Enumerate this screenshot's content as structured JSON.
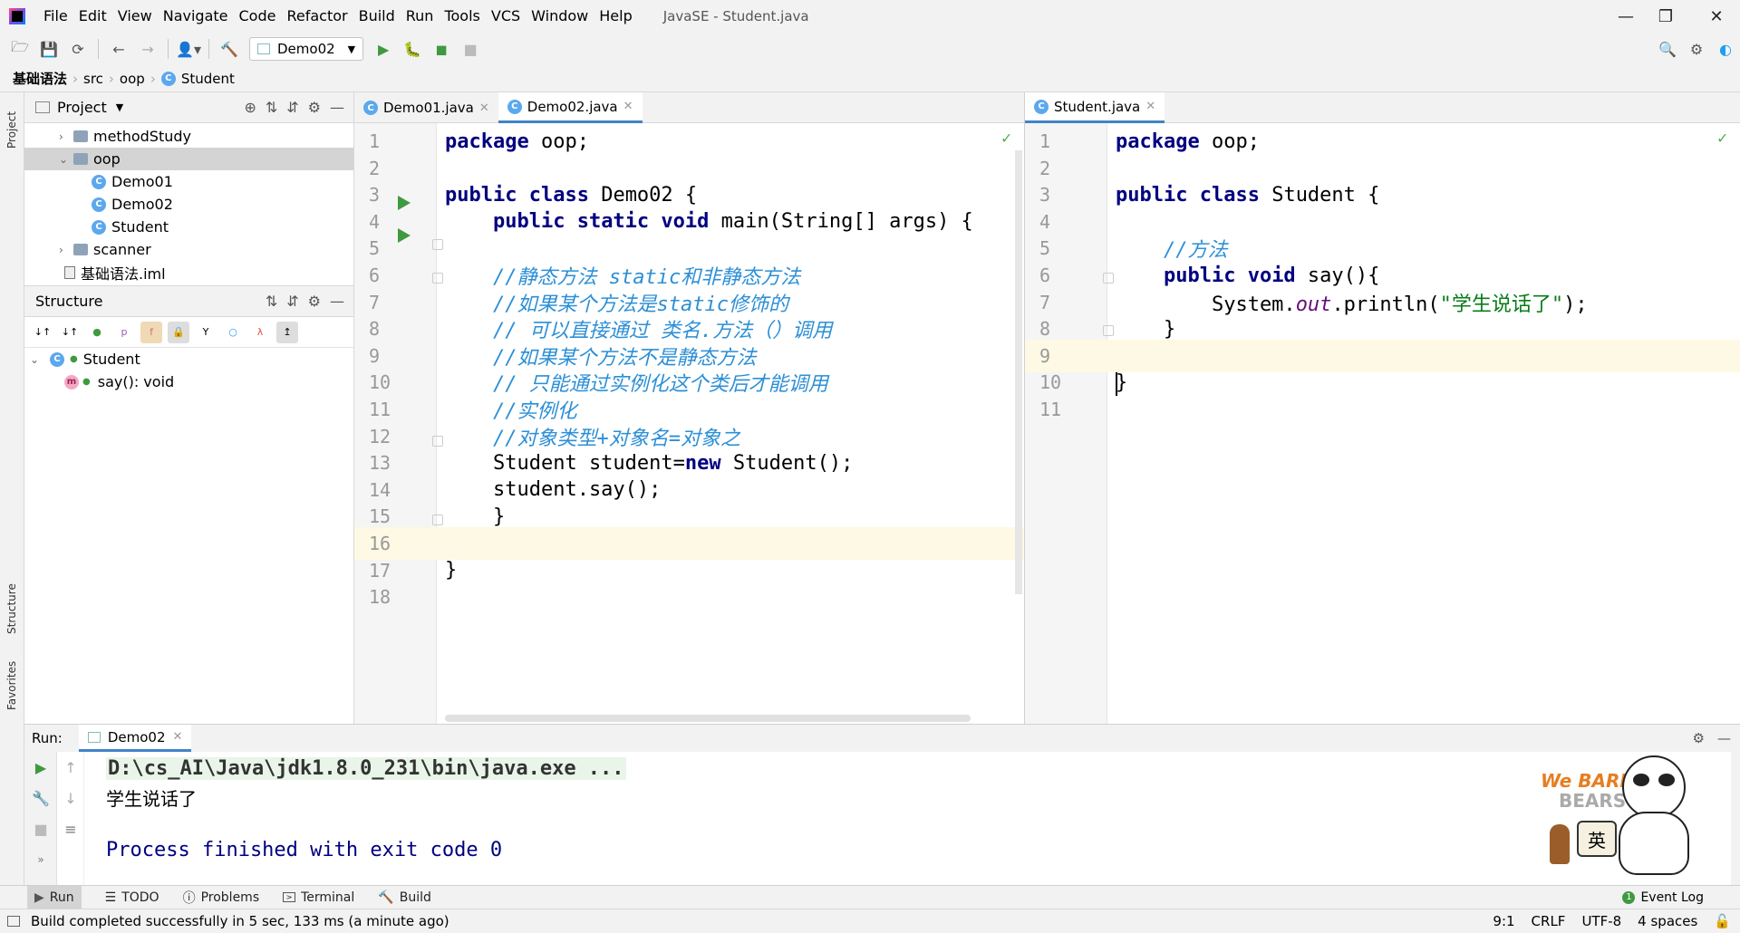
{
  "menubar": {
    "items": [
      "File",
      "Edit",
      "View",
      "Navigate",
      "Code",
      "Refactor",
      "Build",
      "Run",
      "Tools",
      "VCS",
      "Window",
      "Help"
    ],
    "title": "JavaSE - Student.java"
  },
  "toolbar": {
    "run_config": "Demo02"
  },
  "breadcrumb": [
    "基础语法",
    "src",
    "oop",
    "Student"
  ],
  "project_panel": {
    "title": "Project",
    "tab_label": "Project",
    "tree": [
      {
        "label": "methodStudy",
        "type": "folder",
        "indent": 1,
        "expanded": false
      },
      {
        "label": "oop",
        "type": "folder",
        "indent": 1,
        "expanded": true,
        "selected": true
      },
      {
        "label": "Demo01",
        "type": "class",
        "indent": 2
      },
      {
        "label": "Demo02",
        "type": "class",
        "indent": 2
      },
      {
        "label": "Student",
        "type": "class",
        "indent": 2
      },
      {
        "label": "scanner",
        "type": "folder",
        "indent": 1,
        "expanded": false
      },
      {
        "label": "基础语法.iml",
        "type": "file",
        "indent": 1
      }
    ]
  },
  "structure_panel": {
    "title": "Structure",
    "tab_label": "Structure",
    "tree": [
      {
        "label": "Student",
        "kind": "class"
      },
      {
        "label": "say(): void",
        "kind": "method"
      }
    ]
  },
  "favorites_tab": "Favorites",
  "editor_left": {
    "tabs": [
      {
        "label": "Demo01.java",
        "active": false
      },
      {
        "label": "Demo02.java",
        "active": true
      }
    ],
    "lines": [
      {
        "n": "1",
        "html": "<span class='kw'>package</span> oop;"
      },
      {
        "n": "2",
        "html": ""
      },
      {
        "n": "3",
        "html": "<span class='kw'>public class</span> Demo02 {"
      },
      {
        "n": "4",
        "html": "    <span class='kw'>public static void</span> main(String[] args) {"
      },
      {
        "n": "5",
        "html": ""
      },
      {
        "n": "6",
        "html": "    <span class='cm'>//静态方法 static和非静态方法</span>"
      },
      {
        "n": "7",
        "html": "    <span class='cm'>//如果某个方法是static修饰的</span>"
      },
      {
        "n": "8",
        "html": "    <span class='cm'>// 可以直接通过 类名.方法（）调用</span>"
      },
      {
        "n": "9",
        "html": "    <span class='cm'>//如果某个方法不是静态方法</span>"
      },
      {
        "n": "10",
        "html": "    <span class='cm'>// 只能通过实例化这个类后才能调用</span>"
      },
      {
        "n": "11",
        "html": "    <span class='cm'>//实例化</span>"
      },
      {
        "n": "12",
        "html": "    <span class='cm'>//对象类型+对象名=对象之</span>"
      },
      {
        "n": "13",
        "html": "    Student student=<span class='kw'>new</span> Student();"
      },
      {
        "n": "14",
        "html": "    student.say();"
      },
      {
        "n": "15",
        "html": "    }"
      },
      {
        "n": "16",
        "html": ""
      },
      {
        "n": "17",
        "html": "}"
      },
      {
        "n": "18",
        "html": ""
      }
    ]
  },
  "editor_right": {
    "tabs": [
      {
        "label": "Student.java",
        "active": true
      }
    ],
    "lines": [
      {
        "n": "1",
        "html": "<span class='kw'>package</span> oop;"
      },
      {
        "n": "2",
        "html": ""
      },
      {
        "n": "3",
        "html": "<span class='kw'>public class</span> Student {"
      },
      {
        "n": "4",
        "html": ""
      },
      {
        "n": "5",
        "html": "    <span class='cm'>//方法</span>"
      },
      {
        "n": "6",
        "html": "    <span class='kw'>public void</span> say(){"
      },
      {
        "n": "7",
        "html": "        System.<span class='fld'>out</span>.println(<span class='str'>\"学生说话了\"</span>);"
      },
      {
        "n": "8",
        "html": "    }"
      },
      {
        "n": "9",
        "html": ""
      },
      {
        "n": "10",
        "html": "}"
      },
      {
        "n": "11",
        "html": ""
      }
    ]
  },
  "run_panel": {
    "label": "Run:",
    "tab": "Demo02",
    "output": [
      "D:\\cs_AI\\Java\\jdk1.8.0_231\\bin\\java.exe ...",
      "学生说话了",
      "",
      "Process finished with exit code 0"
    ]
  },
  "bottom_tabs": [
    "Run",
    "TODO",
    "Problems",
    "Terminal",
    "Build"
  ],
  "event_log": "Event Log",
  "status": {
    "message": "Build completed successfully in 5 sec, 133 ms (a minute ago)",
    "position": "9:1",
    "line_sep": "CRLF",
    "encoding": "UTF-8",
    "indent": "4 spaces"
  },
  "mascot": {
    "text1": "We BARE",
    "text2": "BEARS",
    "badge": "英"
  }
}
